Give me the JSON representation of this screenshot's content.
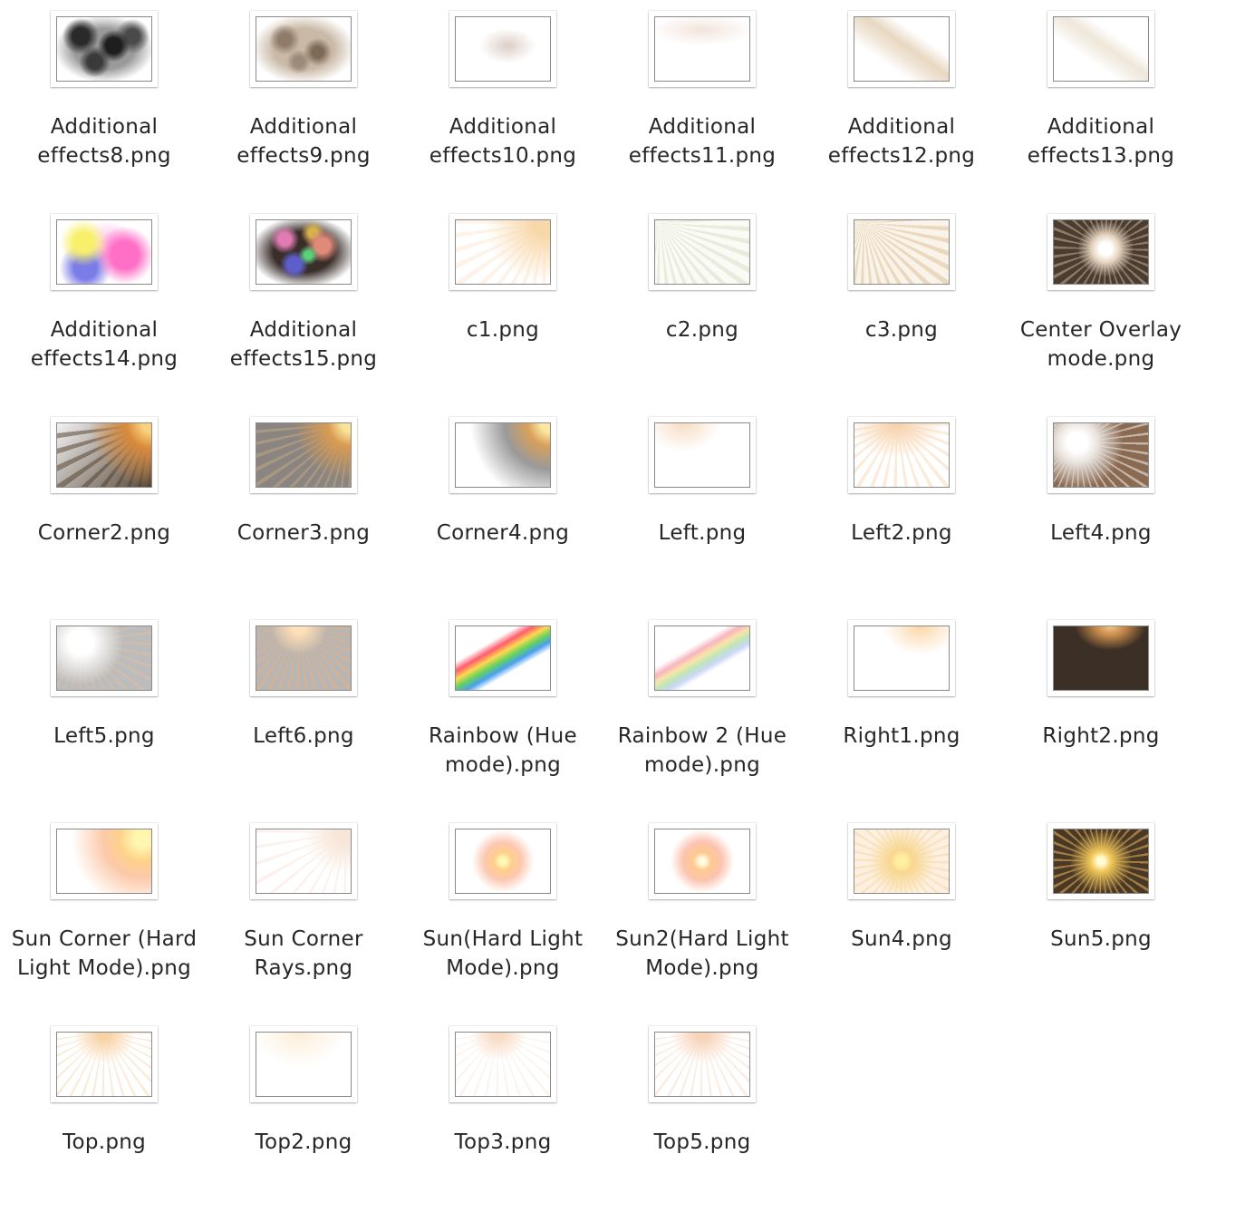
{
  "files": [
    {
      "name": "Additional\neffects8.png",
      "icon": "image-thumbnail-icon",
      "preview": "smoke-dark"
    },
    {
      "name": "Additional\neffects9.png",
      "icon": "image-thumbnail-icon",
      "preview": "smoke-beige"
    },
    {
      "name": "Additional\neffects10.png",
      "icon": "image-thumbnail-icon",
      "preview": "blob-soft"
    },
    {
      "name": "Additional\neffects11.png",
      "icon": "image-thumbnail-icon",
      "preview": "haze-top"
    },
    {
      "name": "Additional\neffects12.png",
      "icon": "image-thumbnail-icon",
      "preview": "streak-beige"
    },
    {
      "name": "Additional\neffects13.png",
      "icon": "image-thumbnail-icon",
      "preview": "streak-light"
    },
    {
      "name": "Additional\neffects14.png",
      "icon": "image-thumbnail-icon",
      "preview": "color-blobs"
    },
    {
      "name": "Additional\neffects15.png",
      "icon": "image-thumbnail-icon",
      "preview": "smoke-color"
    },
    {
      "name": "c1.png",
      "icon": "image-thumbnail-icon",
      "preview": "rays-corner-faint"
    },
    {
      "name": "c2.png",
      "icon": "image-thumbnail-icon",
      "preview": "rays-green-faint"
    },
    {
      "name": "c3.png",
      "icon": "image-thumbnail-icon",
      "preview": "rays-beige"
    },
    {
      "name": "Center Overlay\nmode.png",
      "icon": "image-thumbnail-icon",
      "preview": "burst-dark-center"
    },
    {
      "name": "Corner2.png",
      "icon": "image-thumbnail-icon",
      "preview": "corner-dark-orange"
    },
    {
      "name": "Corner3.png",
      "icon": "image-thumbnail-icon",
      "preview": "corner-gray-rays"
    },
    {
      "name": "Corner4.png",
      "icon": "image-thumbnail-icon",
      "preview": "corner-soft-gray"
    },
    {
      "name": "Left.png",
      "icon": "image-thumbnail-icon",
      "preview": "top-faint-orange"
    },
    {
      "name": "Left2.png",
      "icon": "image-thumbnail-icon",
      "preview": "top-orange-rays"
    },
    {
      "name": "Left4.png",
      "icon": "image-thumbnail-icon",
      "preview": "left-white-brown"
    },
    {
      "name": "Left5.png",
      "icon": "image-thumbnail-icon",
      "preview": "left-white-gray"
    },
    {
      "name": "Left6.png",
      "icon": "image-thumbnail-icon",
      "preview": "gray-rays-orange"
    },
    {
      "name": "Rainbow (Hue\nmode).png",
      "icon": "image-thumbnail-icon",
      "preview": "rainbow-bright"
    },
    {
      "name": "Rainbow 2 (Hue\nmode).png",
      "icon": "image-thumbnail-icon",
      "preview": "rainbow-faint"
    },
    {
      "name": "Right1.png",
      "icon": "image-thumbnail-icon",
      "preview": "top-right-glow"
    },
    {
      "name": "Right2.png",
      "icon": "image-thumbnail-icon",
      "preview": "dark-brown-glow"
    },
    {
      "name": "Sun Corner (Hard\nLight Mode).png",
      "icon": "image-thumbnail-icon",
      "preview": "sun-corner"
    },
    {
      "name": "Sun Corner\nRays.png",
      "icon": "image-thumbnail-icon",
      "preview": "sun-corner-rays"
    },
    {
      "name": "Sun(Hard Light\nMode).png",
      "icon": "image-thumbnail-icon",
      "preview": "sun-center"
    },
    {
      "name": "Sun2(Hard Light\nMode).png",
      "icon": "image-thumbnail-icon",
      "preview": "sun-center-2"
    },
    {
      "name": "Sun4.png",
      "icon": "image-thumbnail-icon",
      "preview": "sun-rays-light"
    },
    {
      "name": "Sun5.png",
      "icon": "image-thumbnail-icon",
      "preview": "sun-rays-dark"
    },
    {
      "name": "Top.png",
      "icon": "image-thumbnail-icon",
      "preview": "top-rays"
    },
    {
      "name": "Top2.png",
      "icon": "image-thumbnail-icon",
      "preview": "top-soft"
    },
    {
      "name": "Top3.png",
      "icon": "image-thumbnail-icon",
      "preview": "top-faint-rays"
    },
    {
      "name": "Top5.png",
      "icon": "image-thumbnail-icon",
      "preview": "top-rays-2"
    }
  ]
}
